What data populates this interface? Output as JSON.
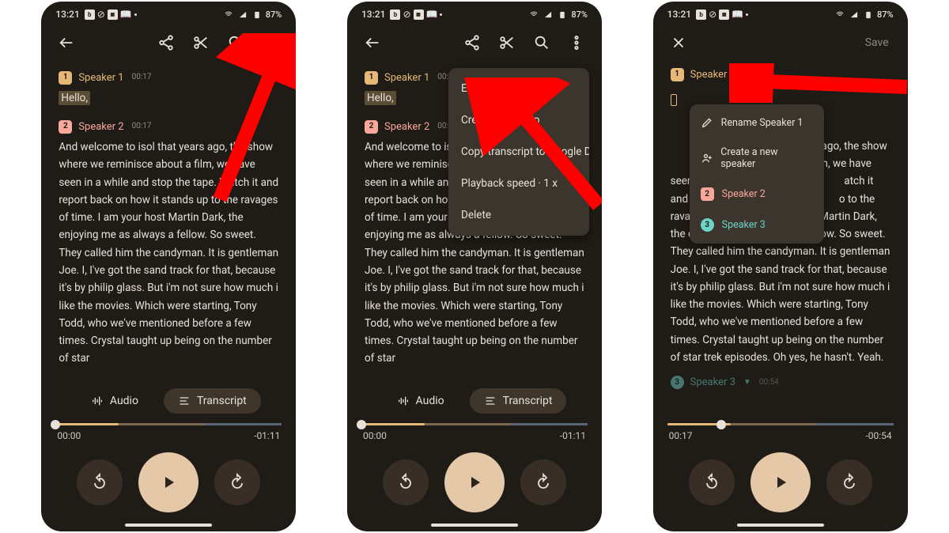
{
  "status": {
    "time": "13:21",
    "battery": "87%"
  },
  "appbar": {
    "save": "Save"
  },
  "transcript": {
    "sp1": {
      "name": "Speaker 1",
      "ts": "00:17",
      "text": "Hello,"
    },
    "sp2": {
      "name": "Speaker 2",
      "ts": "00:17",
      "text": "And welcome to isol that years ago, the show where we reminisce about a film, we have seen in a while and stop the tape. Watch it and report back on how it stands up to the ravages of time. I am your host Martin Dark, the enjoying me as always a fellow. So sweet. They called him the candyman. It is gentleman Joe. I, I've got the sand track for that, because it's by philip glass. But i'm not sure how much i like the movies. Which were starting, Tony Todd, who we've mentioned before a few times. Crystal taught up being on the number of star",
      "text_full": "And welcome to isol that years ago, the show where we reminisce about a film, we have seen in a while and stop the tape. Watch it and report back on how it stands up to the ravages of time. I am your host Martin Dark, the enjoying me as always a fellow. So sweet. They called him the candyman. It is gentleman Joe. I, I've got the sand track for that, because it's by philip glass. But i'm not sure how much i like the movies. Which were starting, Tony Todd, who we've mentioned before a few times. Crystal taught up being on the number of star trek episodes. Oh yes, he hasn't. Yeah."
    },
    "sp3_partial": {
      "name": "Speaker 3",
      "ts": "00:54"
    }
  },
  "tabs": {
    "audio": "Audio",
    "transcript": "Transcript"
  },
  "player": {
    "a": {
      "elapsed": "00:00",
      "remain": "-01:11",
      "thumb": "0%"
    },
    "c": {
      "elapsed": "00:17",
      "remain": "-00:54",
      "thumb": "24%"
    }
  },
  "menu": {
    "edit_labels": "Edit speaker labels",
    "create_video": "Create video clip",
    "copy_docs": "Copy transcript to Google Docs",
    "playback": "Playback speed · 1 x",
    "delete": "Delete"
  },
  "spk_menu": {
    "rename": "Rename Speaker 1",
    "new": "Create a new speaker",
    "sp2": "Speaker 2",
    "sp3": "Speaker 3"
  }
}
